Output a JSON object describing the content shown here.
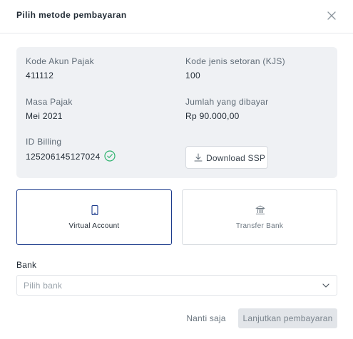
{
  "header": {
    "title": "Pilih metode pembayaran",
    "close_icon": "close-icon"
  },
  "info": {
    "kode_akun_label": "Kode Akun Pajak",
    "kode_akun_value": "411112",
    "kjs_label": "Kode jenis setoran (KJS)",
    "kjs_value": "100",
    "masa_label": "Masa Pajak",
    "masa_value": "Mei 2021",
    "jumlah_label": "Jumlah yang dibayar",
    "jumlah_value": "Rp 90.000,00",
    "billing_label": "ID Billing",
    "billing_value": "125206145127024",
    "billing_status_icon": "check-circle-icon",
    "download_label": "Download SSP",
    "download_icon": "download-icon"
  },
  "methods": [
    {
      "label": "Virtual Account",
      "icon": "mobile-icon",
      "selected": true
    },
    {
      "label": "Transfer Bank",
      "icon": "bank-icon",
      "selected": false
    }
  ],
  "bank": {
    "label": "Bank",
    "placeholder": "Pilih bank"
  },
  "footer": {
    "later_label": "Nanti saja",
    "continue_label": "Lanjutkan pembayaran"
  },
  "colors": {
    "accent": "#1c3b8c",
    "success": "#2fb36f",
    "card_bg": "#eff1f4",
    "disabled_bg": "#e2e5e9"
  }
}
